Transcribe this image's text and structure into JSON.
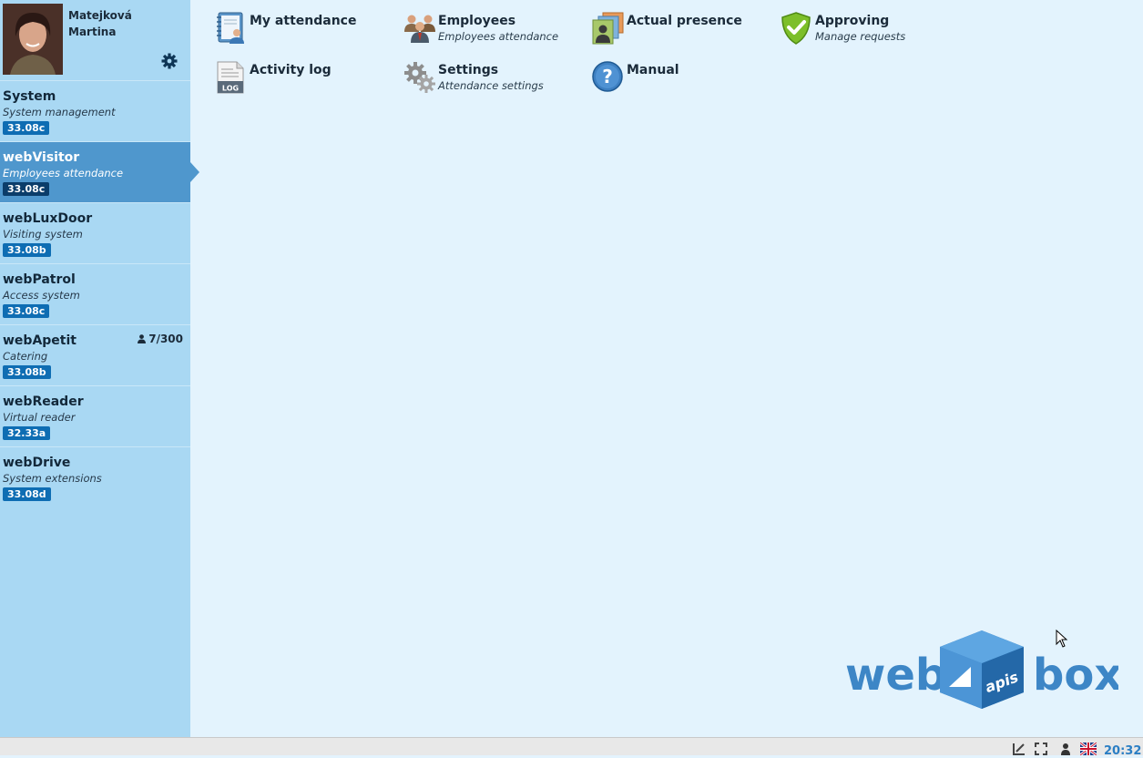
{
  "user": {
    "last_name": "Matejková",
    "first_name": "Martina"
  },
  "apps": [
    {
      "title": "System",
      "subtitle": "System management",
      "version": "33.08c"
    },
    {
      "title": "webVisitor",
      "subtitle": "Employees attendance",
      "version": "33.08c",
      "active": true
    },
    {
      "title": "webLuxDoor",
      "subtitle": "Visiting system",
      "version": "33.08b"
    },
    {
      "title": "webPatrol",
      "subtitle": "Access system",
      "version": "33.08c"
    },
    {
      "title": "webApetit",
      "subtitle": "Catering",
      "version": "33.08b",
      "count": "7/300"
    },
    {
      "title": "webReader",
      "subtitle": "Virtual reader",
      "version": "32.33a"
    },
    {
      "title": "webDrive",
      "subtitle": "System extensions",
      "version": "33.08d"
    }
  ],
  "modules": [
    {
      "title": "My attendance",
      "subtitle": "",
      "icon": "notebook-person-icon"
    },
    {
      "title": "Employees",
      "subtitle": "Employees attendance",
      "icon": "employees-group-icon"
    },
    {
      "title": "Actual presence",
      "subtitle": "",
      "icon": "id-cards-icon"
    },
    {
      "title": "Approving",
      "subtitle": "Manage requests",
      "icon": "shield-check-icon"
    },
    {
      "title": "Activity log",
      "subtitle": "",
      "icon": "log-document-icon"
    },
    {
      "title": "Settings",
      "subtitle": "Attendance settings",
      "icon": "gears-icon"
    },
    {
      "title": "Manual",
      "subtitle": "",
      "icon": "help-icon"
    }
  ],
  "logo": {
    "left": "web",
    "center": "apis",
    "right": "box"
  },
  "icon_labels": {
    "log": "LOG",
    "help": "?"
  },
  "status": {
    "clock": "20:32"
  },
  "colors": {
    "sidebar": "#a9d8f3",
    "active": "#4f97cd",
    "badge": "#0e6db3",
    "content_bg": "#e3f3fd",
    "logo": "#3d86c6"
  }
}
